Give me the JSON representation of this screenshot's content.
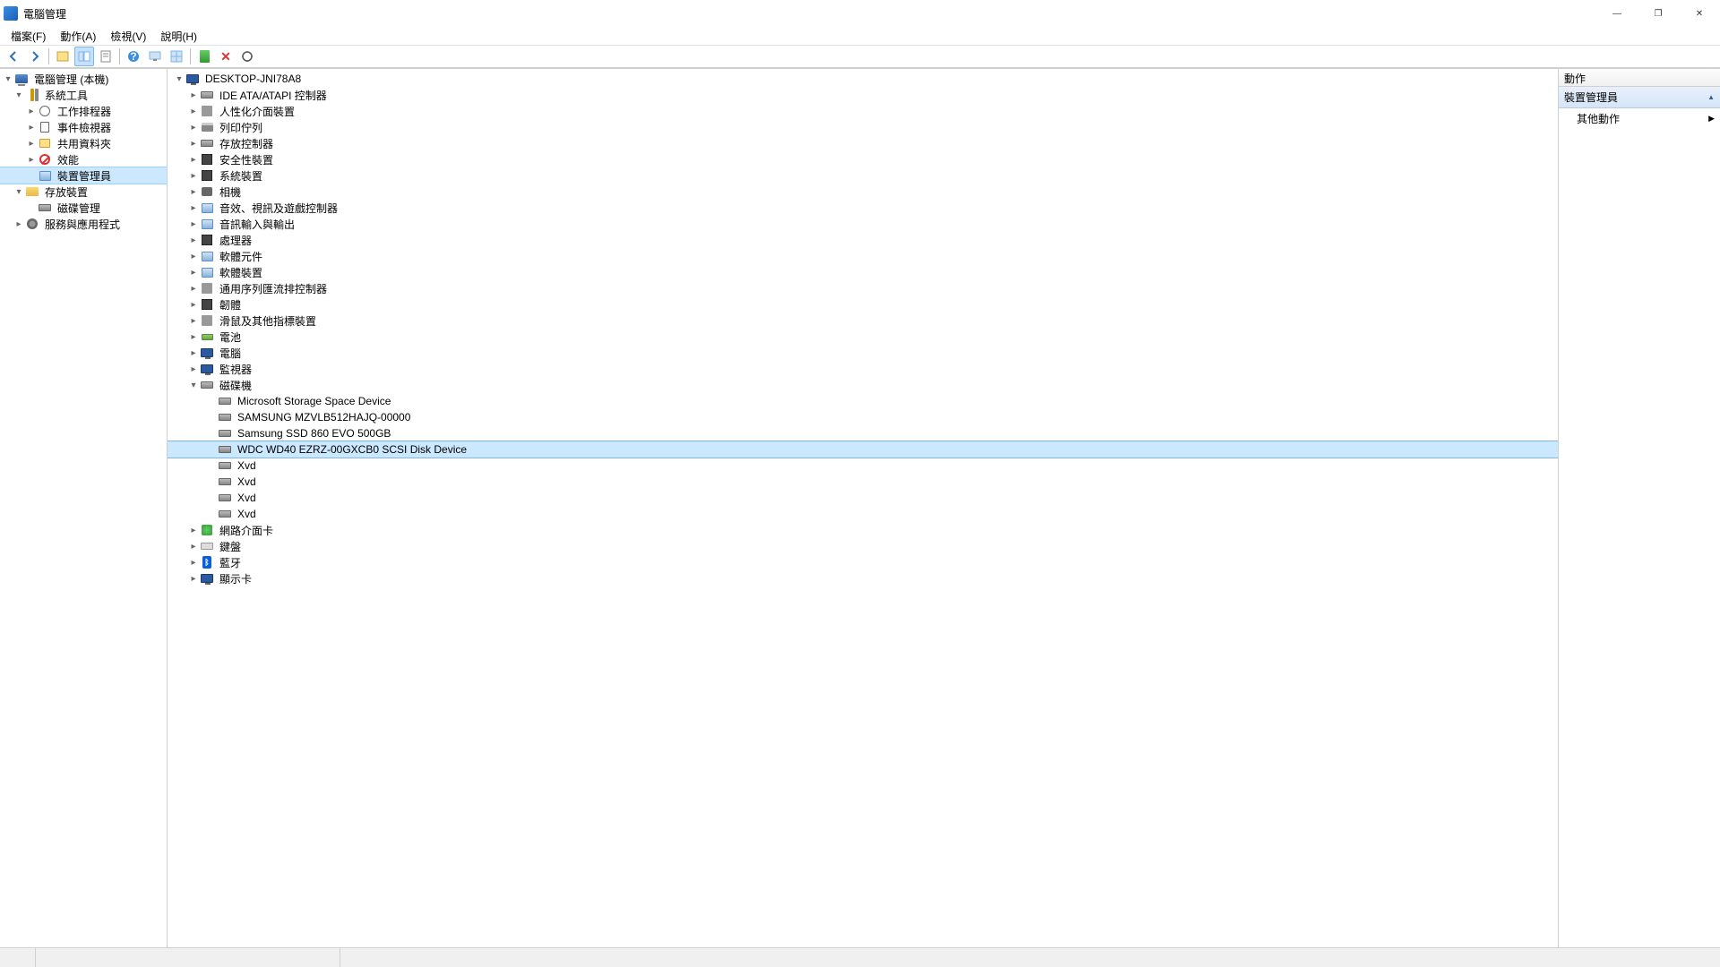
{
  "window": {
    "title": "電腦管理"
  },
  "menu": {
    "file": "檔案(F)",
    "action": "動作(A)",
    "view": "檢視(V)",
    "help": "說明(H)"
  },
  "left_tree": {
    "root": "電腦管理 (本機)",
    "system_tools": "系統工具",
    "task_scheduler": "工作排程器",
    "event_viewer": "事件檢視器",
    "shared_folders": "共用資料夾",
    "performance": "效能",
    "device_manager": "裝置管理員",
    "storage": "存放裝置",
    "disk_management": "磁碟管理",
    "services": "服務與應用程式"
  },
  "device_tree": {
    "computer": "DESKTOP-JNI78A8",
    "categories": [
      {
        "id": "ide",
        "label": "IDE ATA/ATAPI 控制器"
      },
      {
        "id": "hid",
        "label": "人性化介面裝置"
      },
      {
        "id": "print",
        "label": "列印佇列"
      },
      {
        "id": "storage",
        "label": "存放控制器"
      },
      {
        "id": "sec",
        "label": "安全性裝置"
      },
      {
        "id": "sys",
        "label": "系統裝置"
      },
      {
        "id": "cam",
        "label": "相機"
      },
      {
        "id": "sound",
        "label": "音效、視訊及遊戲控制器"
      },
      {
        "id": "audio",
        "label": "音訊輸入與輸出"
      },
      {
        "id": "cpu",
        "label": "處理器"
      },
      {
        "id": "swcomp",
        "label": "軟體元件"
      },
      {
        "id": "swdev",
        "label": "軟體裝置"
      },
      {
        "id": "usb",
        "label": "通用序列匯流排控制器"
      },
      {
        "id": "fw",
        "label": "韌體"
      },
      {
        "id": "mouse",
        "label": "滑鼠及其他指標裝置"
      },
      {
        "id": "batt",
        "label": "電池"
      },
      {
        "id": "comp",
        "label": "電腦"
      },
      {
        "id": "mon",
        "label": "監視器"
      }
    ],
    "disk_cat": "磁碟機",
    "disks": [
      "Microsoft Storage Space Device",
      "SAMSUNG MZVLB512HAJQ-00000",
      "Samsung SSD 860 EVO 500GB",
      "WDC WD40 EZRZ-00GXCB0 SCSI Disk Device",
      "Xvd",
      "Xvd",
      "Xvd",
      "Xvd"
    ],
    "selected_disk_index": 3,
    "after_disks": [
      {
        "id": "net",
        "label": "網路介面卡"
      },
      {
        "id": "kbd",
        "label": "鍵盤"
      },
      {
        "id": "bt",
        "label": "藍牙"
      },
      {
        "id": "disp",
        "label": "顯示卡"
      }
    ]
  },
  "actions_pane": {
    "header": "動作",
    "section": "裝置管理員",
    "other_actions": "其他動作"
  }
}
